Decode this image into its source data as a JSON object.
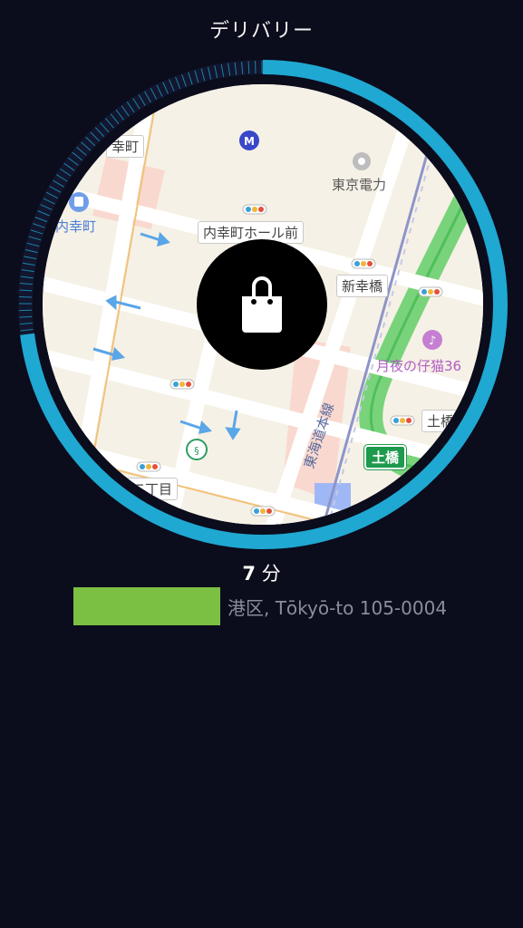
{
  "header": {
    "title": "デリバリー"
  },
  "map": {
    "labels": {
      "uchisaiwaicho_top": "幸町",
      "uchisaiwaicho_station": "内幸町",
      "tepco": "東京電力",
      "hall_mae": "内幸町ホール前",
      "shinsaiwai_bridge": "新幸橋",
      "tsukiyo": "月夜の仔猫36",
      "tsuchihashi_road": "土橋",
      "tsuchihashi_exit": "土橋",
      "tokaido_line": "東海道本線",
      "nichome": "二丁目"
    }
  },
  "order": {
    "eta_value": "7",
    "eta_unit": "分",
    "address": "港区, Tōkyō-to 105-0004"
  },
  "colors": {
    "background": "#0b0c1c",
    "ring": "#1fa8d1",
    "address_block": "#7cc043"
  },
  "icons": {
    "center": "shopping-bag-icon",
    "metro": "metro-icon",
    "train": "train-station-icon",
    "music": "music-icon",
    "tepco": "landmark-icon"
  },
  "progress": {
    "fraction": 0.73
  }
}
